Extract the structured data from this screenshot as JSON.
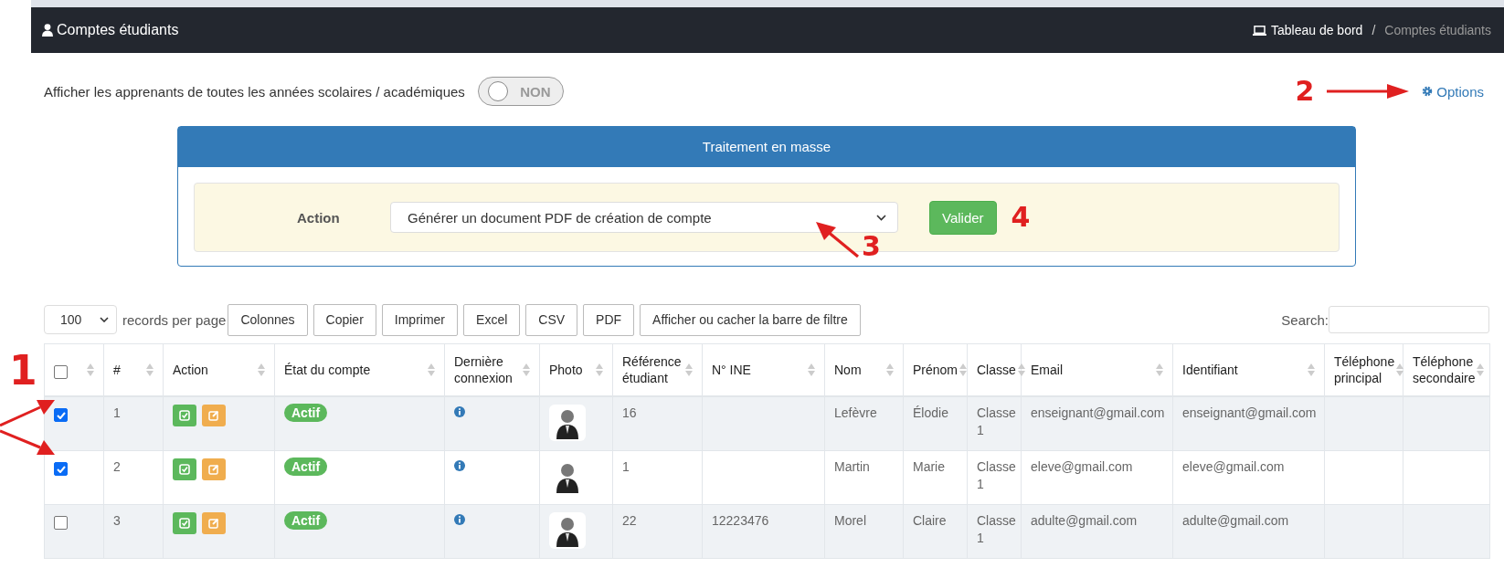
{
  "header": {
    "title": "Comptes étudiants",
    "breadcrumb": [
      {
        "label": "Tableau de bord",
        "link": true
      },
      {
        "label": "Comptes étudiants",
        "link": false
      }
    ],
    "separator": "/"
  },
  "toggle": {
    "label": "Afficher les apprenants de toutes les années scolaires / académiques",
    "on": false,
    "text": "NON"
  },
  "options_link": "Options",
  "bulk": {
    "title": "Traitement en masse",
    "action_label": "Action",
    "selected_action": "Générer un document PDF de création de compte",
    "submit": "Valider"
  },
  "toolbar": {
    "page_size": "100",
    "page_size_label": "records per page",
    "buttons": [
      "Colonnes",
      "Copier",
      "Imprimer",
      "Excel",
      "CSV",
      "PDF",
      "Afficher ou cacher la barre de filtre"
    ],
    "search_label": "Search:"
  },
  "table": {
    "select_all": false,
    "columns": [
      "#",
      "Action",
      "État du compte",
      "Dernière connexion",
      "Photo",
      "Référence étudiant",
      "N° INE",
      "Nom",
      "Prénom",
      "Classe",
      "Email",
      "Identifiant",
      "Téléphone principal",
      "Téléphone secondaire"
    ],
    "rows": [
      {
        "checked": true,
        "num": "1",
        "status": "Actif",
        "ref": "16",
        "nom": "Lefèvre",
        "prenom": "Élodie",
        "classe": "Classe 1",
        "email": "enseignant@gmail.com",
        "identifiant": "enseignant@gmail.com"
      },
      {
        "checked": true,
        "num": "2",
        "status": "Actif",
        "ref": "1",
        "nom": "Martin",
        "prenom": "Marie",
        "classe": "Classe 1",
        "email": "eleve@gmail.com",
        "identifiant": "eleve@gmail.com"
      },
      {
        "checked": false,
        "num": "3",
        "status": "Actif",
        "ref": "22",
        "ine": "12223476",
        "nom": "Morel",
        "prenom": "Claire",
        "classe": "Classe 1",
        "email": "adulte@gmail.com",
        "identifiant": "adulte@gmail.com"
      }
    ]
  },
  "annotations": {
    "checkboxes": "1",
    "options": "2",
    "select": "3",
    "submit": "4"
  }
}
